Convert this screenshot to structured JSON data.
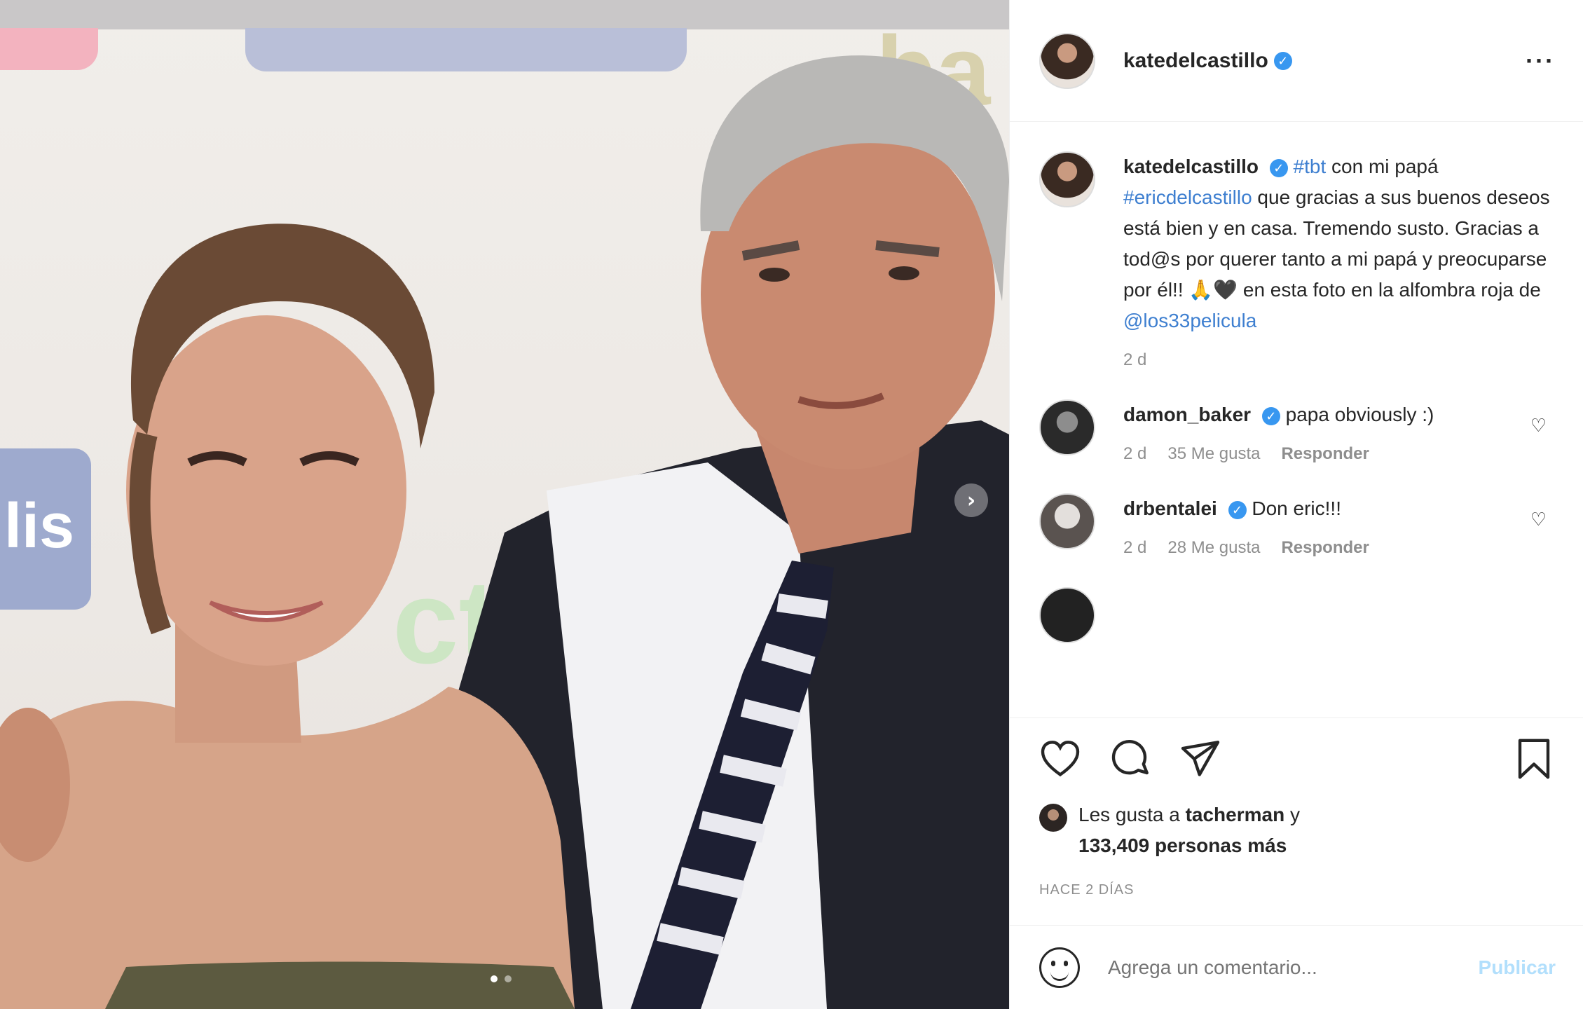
{
  "post": {
    "author": "katedelcastillo",
    "caption": {
      "hashtag": "#tbt",
      "text1": " con mi papá ",
      "mention1": "#ericdelcastillo",
      "text2": " que gracias a sus buenos deseos está bien y en casa. Tremendo susto. Gracias a tod@s por querer tanto a mi papá y preocuparse por él!! 🙏🖤 en esta foto en la alfombra roja de ",
      "mention2": "@los33pelicula",
      "time": "2 d"
    },
    "comments": [
      {
        "user": "damon_baker",
        "text": "papa obviously :)",
        "time": "2 d",
        "likes": "35 Me gusta",
        "reply": "Responder"
      },
      {
        "user": "drbentalei",
        "text": "Don eric!!!",
        "time": "2 d",
        "likes": "28 Me gusta",
        "reply": "Responder"
      }
    ],
    "likes": {
      "prefix": "Les gusta a ",
      "user": "tacherman",
      "suffix": " y",
      "count": "133,409 personas más"
    },
    "timestamp": "HACE 2 DÍAS",
    "add_comment": {
      "placeholder": "Agrega un comentario...",
      "button": "Publicar"
    }
  },
  "icons": {
    "more": "more-options-icon",
    "like": "heart-icon",
    "comment": "comment-icon",
    "share": "share-icon",
    "save": "bookmark-icon",
    "emoji": "emoji-icon",
    "carousel": "chevron-right-icon"
  },
  "colors": {
    "link": "#3e7fd0",
    "verified": "#3897f0",
    "meta": "#8e8e8e",
    "publish": "#b2dffc"
  }
}
